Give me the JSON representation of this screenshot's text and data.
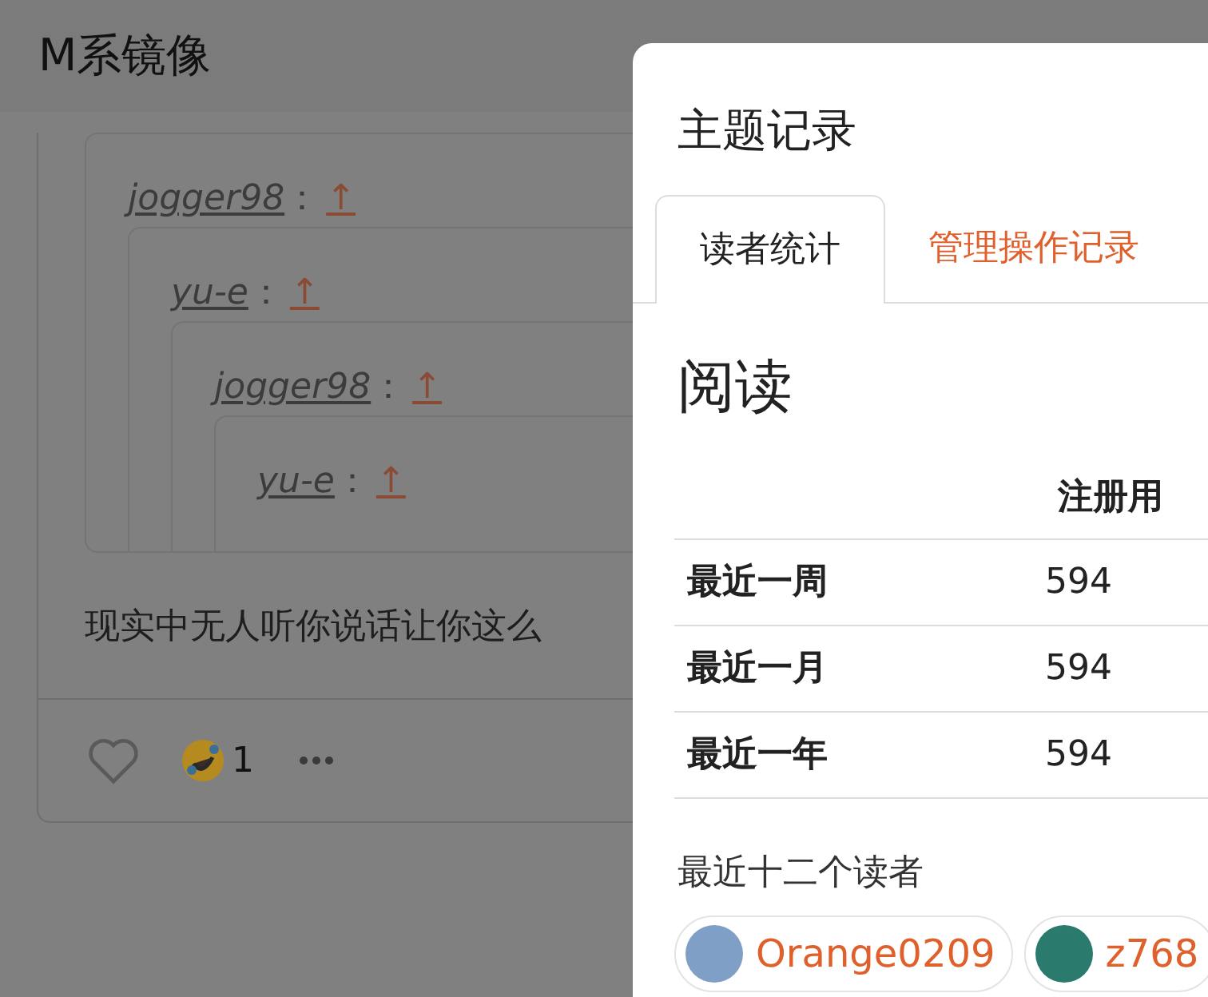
{
  "header": {
    "title": "M系镜像"
  },
  "quote": {
    "user": "jogger98",
    "sep": "：",
    "arrow": "↑",
    "children": [
      {
        "user": "yu-e",
        "sep": "：",
        "arrow": "↑",
        "children": [
          {
            "user": "jogger98",
            "sep": "：",
            "arrow": "↑",
            "children": [
              {
                "user": "yu-e",
                "sep": "：",
                "arrow": "↑"
              }
            ]
          }
        ]
      }
    ]
  },
  "comment": {
    "text": "现实中无人听你说话让你这么",
    "reaction_count": "1",
    "liked": false
  },
  "dialog": {
    "title": "主题记录",
    "tabs": [
      {
        "label": "读者统计",
        "selected": true
      },
      {
        "label": "管理操作记录",
        "selected": false
      }
    ],
    "heading": "阅读",
    "table": {
      "columns": [
        "注册用"
      ],
      "rows": [
        {
          "label": "最近一周",
          "cells": [
            "594"
          ]
        },
        {
          "label": "最近一月",
          "cells": [
            "594"
          ]
        },
        {
          "label": "最近一年",
          "cells": [
            "594"
          ]
        }
      ]
    },
    "readers_title": "最近十二个读者",
    "readers": [
      {
        "name": "Orange0209",
        "color": "#7f9fc6"
      },
      {
        "name": "z768",
        "color": "#2b7a6e"
      }
    ]
  }
}
